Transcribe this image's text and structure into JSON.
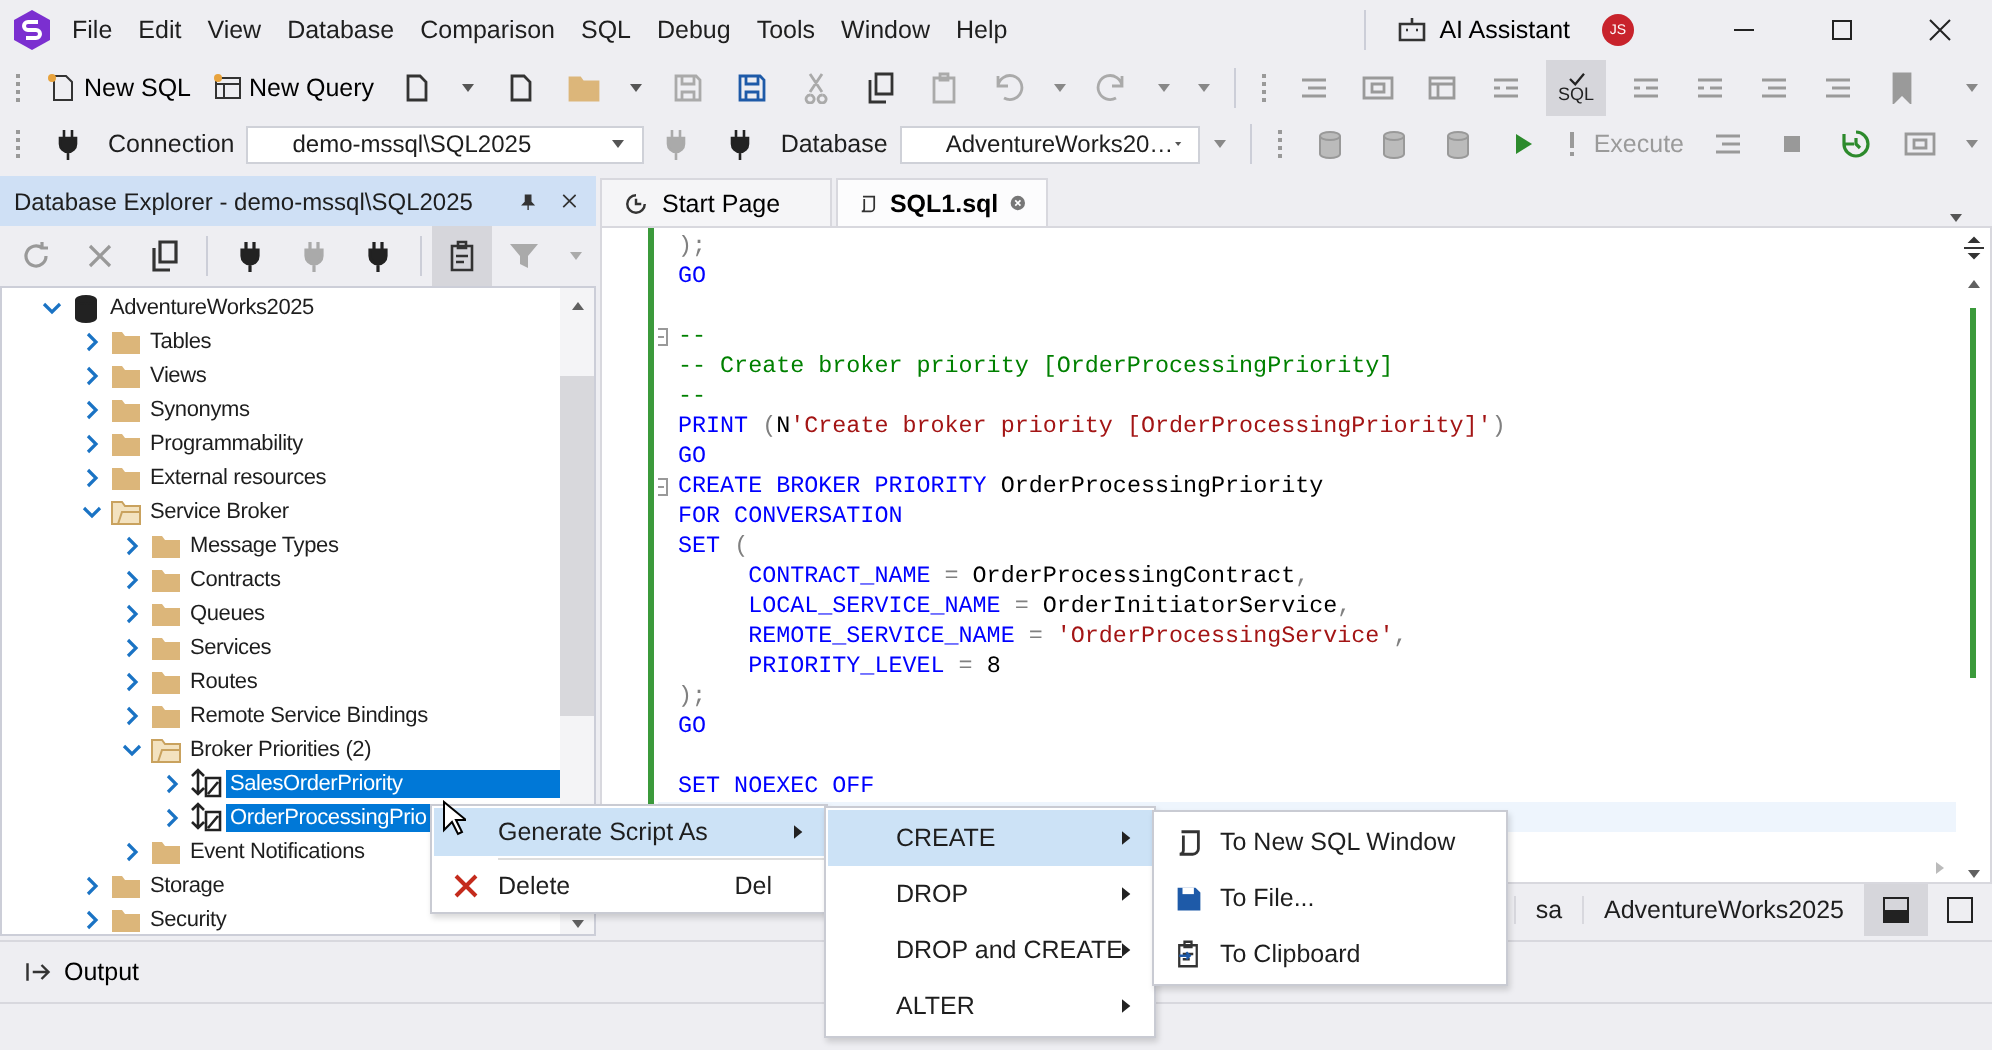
{
  "menu_bar": {
    "items": [
      "File",
      "Edit",
      "View",
      "Database",
      "Comparison",
      "SQL",
      "Debug",
      "Tools",
      "Window",
      "Help"
    ],
    "ai_assistant": "AI Assistant",
    "user_initials": "JS"
  },
  "toolbar": {
    "new_sql": "New SQL",
    "new_query": "New Query",
    "sql_toggle": {
      "label": "SQL",
      "selected": true
    }
  },
  "connection_bar": {
    "connection_label": "Connection",
    "connection": "demo-mssql\\SQL2025",
    "database_label": "Database",
    "database": "AdventureWorks20…",
    "execute": {
      "label": "Execute",
      "disabled": true
    }
  },
  "explorer": {
    "title": "Database Explorer - demo-mssql\\SQL2025",
    "tree": [
      {
        "kind": "database",
        "label": "AdventureWorks2025",
        "expanded": true,
        "selected": false,
        "children": [
          {
            "kind": "folder",
            "label": "Tables",
            "expanded": false,
            "selected": false
          },
          {
            "kind": "folder",
            "label": "Views",
            "expanded": false,
            "selected": false
          },
          {
            "kind": "folder",
            "label": "Synonyms",
            "expanded": false,
            "selected": false
          },
          {
            "kind": "folder",
            "label": "Programmability",
            "expanded": false,
            "selected": false
          },
          {
            "kind": "folder",
            "label": "External resources",
            "expanded": false,
            "selected": false
          },
          {
            "kind": "folder",
            "label": "Service Broker",
            "expanded": true,
            "selected": false,
            "children": [
              {
                "kind": "folder",
                "label": "Message Types",
                "expanded": false,
                "selected": false
              },
              {
                "kind": "folder",
                "label": "Contracts",
                "expanded": false,
                "selected": false
              },
              {
                "kind": "folder",
                "label": "Queues",
                "expanded": false,
                "selected": false
              },
              {
                "kind": "folder",
                "label": "Services",
                "expanded": false,
                "selected": false
              },
              {
                "kind": "folder",
                "label": "Routes",
                "expanded": false,
                "selected": false
              },
              {
                "kind": "folder",
                "label": "Remote Service Bindings",
                "expanded": false,
                "selected": false
              },
              {
                "kind": "folder",
                "label": "Broker Priorities (2)",
                "expanded": true,
                "selected": false,
                "children": [
                  {
                    "kind": "priority",
                    "label": "SalesOrderPriority",
                    "expanded": false,
                    "selected": true
                  },
                  {
                    "kind": "priority",
                    "label": "OrderProcessingPrio",
                    "expanded": false,
                    "selected": true
                  }
                ]
              },
              {
                "kind": "folder",
                "label": "Event Notifications",
                "expanded": false,
                "selected": false
              }
            ]
          },
          {
            "kind": "folder",
            "label": "Storage",
            "expanded": false,
            "selected": false
          },
          {
            "kind": "folder",
            "label": "Security",
            "expanded": false,
            "selected": false
          }
        ]
      }
    ]
  },
  "tabs": [
    {
      "label": "Start Page",
      "selected": false
    },
    {
      "label": "SQL1.sql",
      "selected": true
    }
  ],
  "editor": {
    "lines": [
      {
        "kind": "code",
        "fold": false,
        "current": false,
        "segments": [
          {
            "kind": "punct",
            "text": ");"
          }
        ]
      },
      {
        "kind": "code",
        "fold": false,
        "current": false,
        "segments": [
          {
            "kind": "keyword",
            "text": "GO"
          }
        ]
      },
      {
        "kind": "blank",
        "fold": false,
        "current": false
      },
      {
        "kind": "code",
        "fold": true,
        "current": false,
        "segments": [
          {
            "kind": "comment",
            "text": "--"
          }
        ]
      },
      {
        "kind": "code",
        "fold": false,
        "current": false,
        "segments": [
          {
            "kind": "comment",
            "text": "-- Create broker priority [OrderProcessingPriority]"
          }
        ]
      },
      {
        "kind": "code",
        "fold": false,
        "current": false,
        "segments": [
          {
            "kind": "comment",
            "text": "--"
          }
        ]
      },
      {
        "kind": "code",
        "fold": false,
        "current": false,
        "segments": [
          {
            "kind": "keyword",
            "text": "PRINT "
          },
          {
            "kind": "punct",
            "text": "("
          },
          {
            "kind": "ident",
            "text": "N"
          },
          {
            "kind": "string",
            "text": "'Create broker priority [OrderProcessingPriority]'"
          },
          {
            "kind": "punct",
            "text": ")"
          }
        ]
      },
      {
        "kind": "code",
        "fold": false,
        "current": false,
        "segments": [
          {
            "kind": "keyword",
            "text": "GO"
          }
        ]
      },
      {
        "kind": "code",
        "fold": true,
        "current": false,
        "segments": [
          {
            "kind": "keyword",
            "text": "CREATE BROKER PRIORITY "
          },
          {
            "kind": "ident",
            "text": "OrderProcessingPriority"
          }
        ]
      },
      {
        "kind": "code",
        "fold": false,
        "current": false,
        "segments": [
          {
            "kind": "keyword",
            "text": "FOR CONVERSATION"
          }
        ]
      },
      {
        "kind": "code",
        "fold": false,
        "current": false,
        "segments": [
          {
            "kind": "keyword",
            "text": "SET "
          },
          {
            "kind": "punct",
            "text": "("
          }
        ]
      },
      {
        "kind": "code",
        "fold": false,
        "current": false,
        "segments": [
          {
            "kind": "keyword",
            "text": "     CONTRACT_NAME "
          },
          {
            "kind": "punct",
            "text": "= "
          },
          {
            "kind": "ident",
            "text": "OrderProcessingContract"
          },
          {
            "kind": "punct",
            "text": ","
          }
        ]
      },
      {
        "kind": "code",
        "fold": false,
        "current": false,
        "segments": [
          {
            "kind": "keyword",
            "text": "     LOCAL_SERVICE_NAME "
          },
          {
            "kind": "punct",
            "text": "= "
          },
          {
            "kind": "ident",
            "text": "OrderInitiatorService"
          },
          {
            "kind": "punct",
            "text": ","
          }
        ]
      },
      {
        "kind": "code",
        "fold": false,
        "current": false,
        "segments": [
          {
            "kind": "keyword",
            "text": "     REMOTE_SERVICE_NAME "
          },
          {
            "kind": "punct",
            "text": "= "
          },
          {
            "kind": "string",
            "text": "'OrderProcessingService'"
          },
          {
            "kind": "punct",
            "text": ","
          }
        ]
      },
      {
        "kind": "code",
        "fold": false,
        "current": false,
        "segments": [
          {
            "kind": "keyword",
            "text": "     PRIORITY_LEVEL "
          },
          {
            "kind": "punct",
            "text": "= "
          },
          {
            "kind": "ident",
            "text": "8"
          }
        ]
      },
      {
        "kind": "code",
        "fold": false,
        "current": false,
        "segments": [
          {
            "kind": "punct",
            "text": ");"
          }
        ]
      },
      {
        "kind": "code",
        "fold": false,
        "current": false,
        "segments": [
          {
            "kind": "keyword",
            "text": "GO"
          }
        ]
      },
      {
        "kind": "blank",
        "fold": false,
        "current": false
      },
      {
        "kind": "code",
        "fold": false,
        "current": false,
        "segments": [
          {
            "kind": "keyword",
            "text": "SET NOEXEC OFF"
          }
        ]
      },
      {
        "kind": "blank",
        "fold": false,
        "current": true
      }
    ]
  },
  "status_bar": {
    "items": [
      "sa",
      "AdventureWorks2025"
    ]
  },
  "context_menu": {
    "items": [
      {
        "kind": "script",
        "label": "Generate Script As",
        "submenu": true,
        "selected": true
      },
      {
        "kind": "delete",
        "label": "Delete",
        "shortcut": "Del",
        "submenu": false,
        "selected": false
      }
    ]
  },
  "script_menu": {
    "items": [
      {
        "label": "CREATE",
        "submenu": true,
        "selected": true
      },
      {
        "label": "DROP",
        "submenu": true,
        "selected": false
      },
      {
        "label": "DROP and CREATE",
        "submenu": true,
        "selected": false
      },
      {
        "label": "ALTER",
        "submenu": true,
        "selected": false
      }
    ]
  },
  "target_menu": {
    "items": [
      {
        "kind": "window",
        "label": "To New SQL Window"
      },
      {
        "kind": "file",
        "label": "To File..."
      },
      {
        "kind": "clipboard",
        "label": "To Clipboard"
      }
    ]
  },
  "output_panel": {
    "label": "Output"
  }
}
